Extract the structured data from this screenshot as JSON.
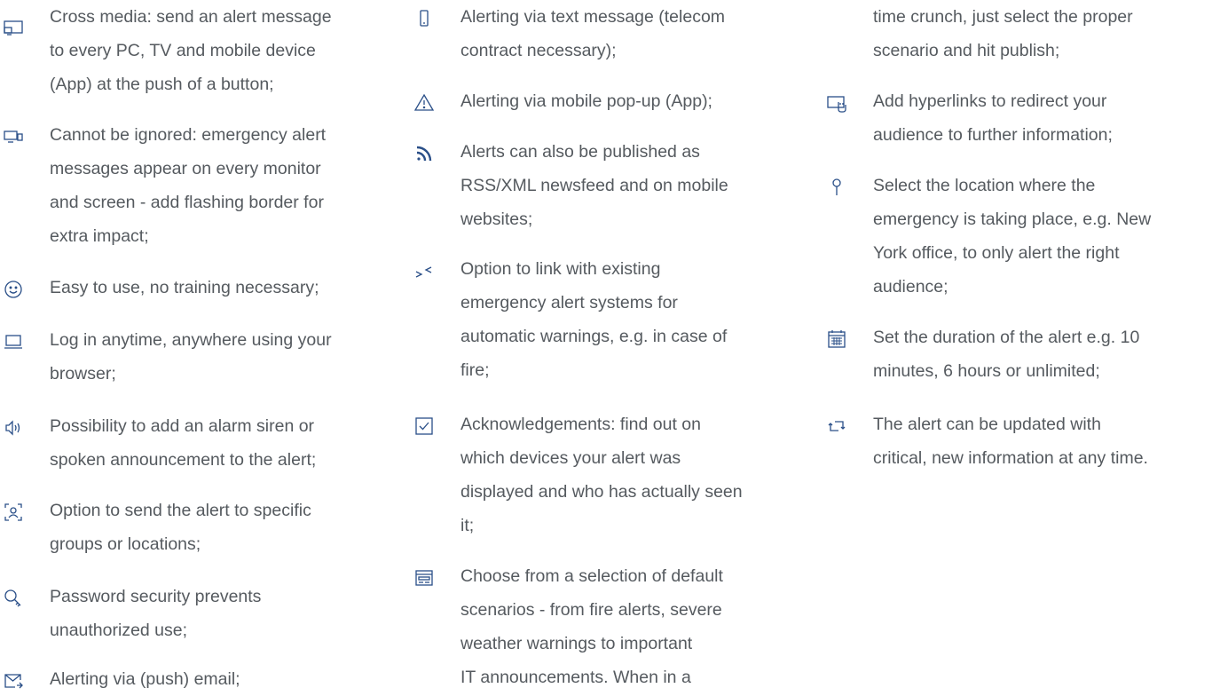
{
  "accent_color": "#2a4f88",
  "text_color": "#555a5f",
  "columns": [
    {
      "items": [
        {
          "icon": "monitor-screen-icon",
          "text": "Cross media: send an alert message\nto every PC, TV and mobile device\n(App) at the push of a button;"
        },
        {
          "icon": "multi-screen-icon",
          "text": "Cannot be ignored: emergency alert\nmessages appear on every monitor\nand screen - add flashing border for\nextra impact;"
        },
        {
          "icon": "smiley-icon",
          "text": "Easy to use, no training necessary;"
        },
        {
          "icon": "laptop-icon",
          "text": "Log in anytime, anywhere using your\nbrowser;"
        },
        {
          "icon": "speaker-icon",
          "text": "Possibility to add an alarm siren or\nspoken announcement to the alert;"
        },
        {
          "icon": "user-target-icon",
          "text": "Option to send the alert to specific\ngroups or locations;"
        },
        {
          "icon": "key-icon",
          "text": "Password security prevents\nunauthorized use;"
        },
        {
          "icon": "email-icon",
          "text": "Alerting via (push) email;"
        }
      ]
    },
    {
      "items": [
        {
          "icon": "mobile-phone-icon",
          "text": "Alerting via text message (telecom\ncontract necessary);"
        },
        {
          "icon": "warning-triangle-icon",
          "text": "Alerting via mobile pop-up (App);"
        },
        {
          "icon": "rss-icon",
          "text": "Alerts can also be published as\nRSS/XML newsfeed and on mobile\nwebsites;"
        },
        {
          "icon": "link-arrows-icon",
          "text": "Option to link with existing\nemergency alert systems for\nautomatic warnings, e.g. in case of\nfire;"
        },
        {
          "icon": "checkbox-icon",
          "text": "Acknowledgements: find out on\nwhich devices your alert was\ndisplayed and who has actually seen\nit;"
        },
        {
          "icon": "template-icon",
          "text": "Choose from a selection of default\nscenarios - from fire alerts, severe\nweather warnings to important\nIT announcements. When in a"
        }
      ]
    },
    {
      "items": [
        {
          "icon": "",
          "text": "time crunch, just select the proper\nscenario and hit publish;"
        },
        {
          "icon": "hyperlink-click-icon",
          "text": "Add hyperlinks to redirect your\naudience to further information;"
        },
        {
          "icon": "location-pin-icon",
          "text": "Select the location where the\nemergency is taking place, e.g. New\nYork office, to only alert the right\naudience;"
        },
        {
          "icon": "calendar-icon",
          "text": "Set the duration of the alert e.g. 10\nminutes, 6 hours or unlimited;"
        },
        {
          "icon": "refresh-arrows-icon",
          "text": "The alert can be updated with\ncritical, new information at any time."
        }
      ]
    }
  ]
}
